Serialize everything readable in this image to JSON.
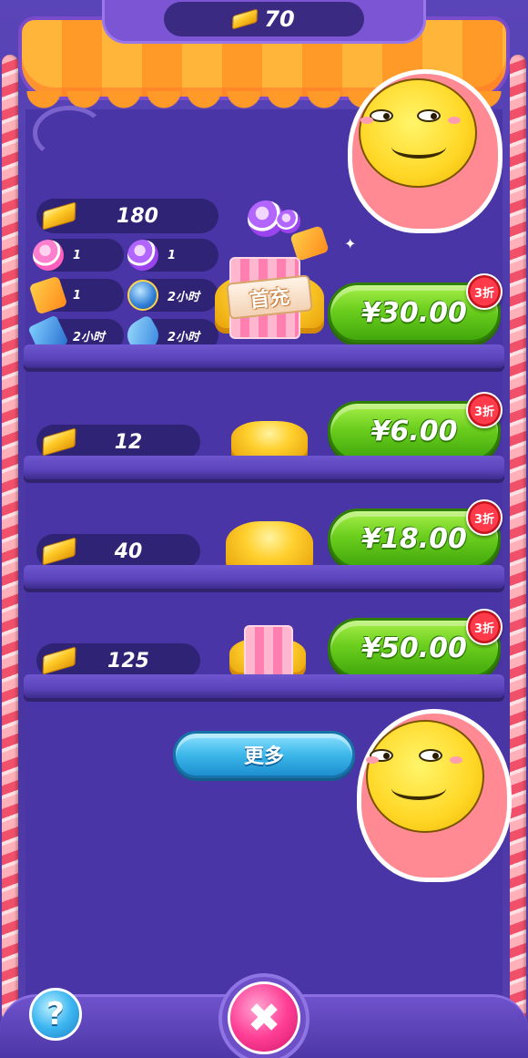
{
  "header": {
    "currency_icon": "gold-bar-icon",
    "currency_amount": "70"
  },
  "first_offer": {
    "gold_amount": "180",
    "label": "首充",
    "items": [
      {
        "icon": "pink-lollipop-icon",
        "text": "1"
      },
      {
        "icon": "purple-lollipop-icon",
        "text": "1"
      },
      {
        "icon": "wrapped-candy-icon",
        "text": "1"
      },
      {
        "icon": "booster-orb-icon",
        "text": "2小时"
      },
      {
        "icon": "ticket-icon",
        "text": "2小时"
      },
      {
        "icon": "fish-icon",
        "text": "2小时"
      }
    ],
    "price": "¥30.00",
    "discount": "3折"
  },
  "offers": [
    {
      "gold_amount": "12",
      "price": "¥6.00",
      "discount": "3折"
    },
    {
      "gold_amount": "40",
      "price": "¥18.00",
      "discount": "3折"
    },
    {
      "gold_amount": "125",
      "price": "¥50.00",
      "discount": "3折"
    }
  ],
  "more_button": "更多",
  "help_button": "?",
  "close_button": "✖",
  "colors": {
    "background": "#4a35a6",
    "buy_button": "#6ccf1e",
    "more_button": "#3cb8ea",
    "close_button": "#ff3f96",
    "discount_badge": "#ff3a4a"
  }
}
